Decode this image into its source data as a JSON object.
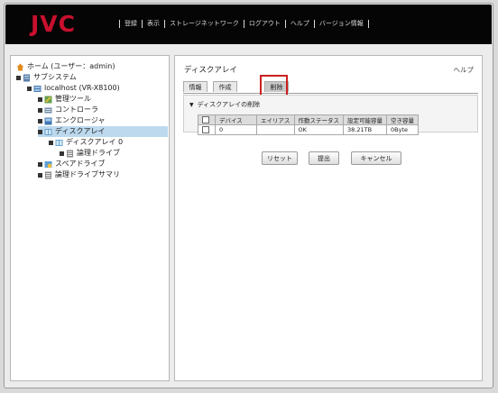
{
  "header": {
    "logo": "JVC",
    "menu": [
      "登録",
      "表示",
      "ストレージネットワーク",
      "ログアウト",
      "ヘルプ",
      "バージョン情報"
    ]
  },
  "tree": {
    "home": "ホーム (ユーザー：admin)",
    "system": "サブシステム",
    "host": "localhost (VR-X8100)",
    "mgmt_tool": "管理ツール",
    "controller": "コントローラ",
    "enclosure": "エンクロージャ",
    "disk_array": "ディスクアレイ",
    "disk_array_0": "ディスクアレイ 0",
    "logical_drive": "論理ドライブ",
    "spare_drive": "スペアドライブ",
    "logical_summary": "論理ドライブサマリ"
  },
  "main": {
    "title": "ディスクアレイ",
    "help": "ヘルプ",
    "tabs": [
      "情報",
      "作成",
      "削除"
    ],
    "section_title": "ディスクアレイの削除",
    "columns": [
      "デバイス",
      "エイリアス",
      "作動ステータス",
      "設定可能容量",
      "空き容量"
    ],
    "rows": [
      {
        "device": "0",
        "alias": "",
        "status": "OK",
        "capacity": "38.21TB",
        "free": "0Byte"
      }
    ],
    "buttons": {
      "reset": "リセット",
      "submit": "提出",
      "cancel": "キャンセル"
    }
  },
  "colors": {
    "brand": "#c8102e",
    "highlight": "#cc1f1f",
    "selected": "#bcd9ee"
  }
}
